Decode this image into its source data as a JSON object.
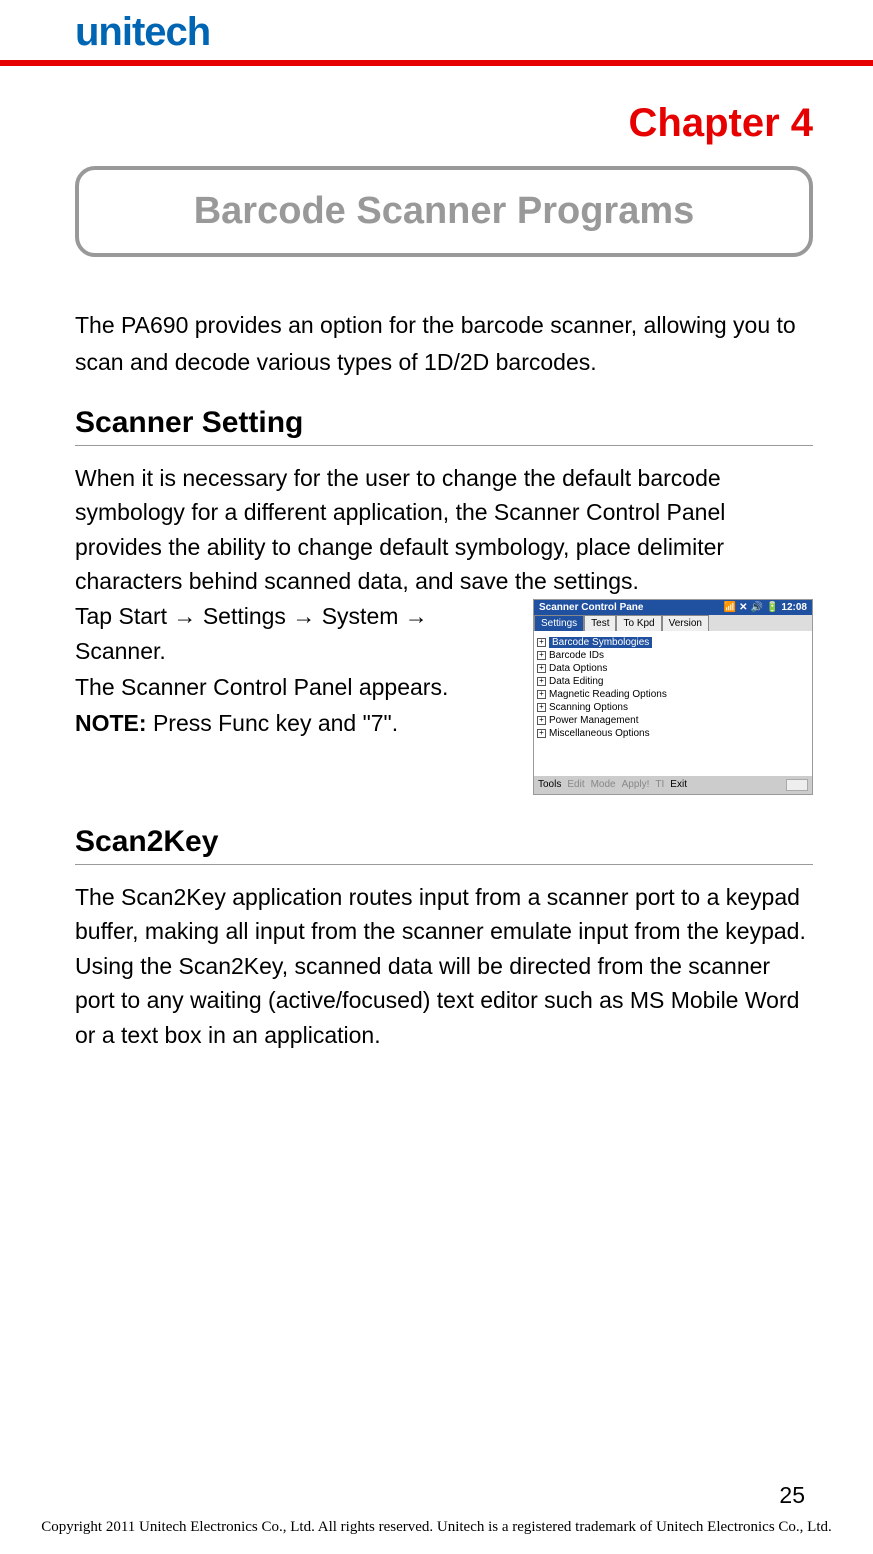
{
  "logo": "unitech",
  "chapter_label": "Chapter  4",
  "chapter_title": "Barcode Scanner Programs",
  "intro": "The PA690 provides an option for the barcode scanner, allowing you to scan and decode various types of 1D/2D barcodes.",
  "sections": {
    "scanner_setting": {
      "heading": "Scanner Setting",
      "para1": "When it is necessary for the user to change the default barcode symbology for a different application, the Scanner Control Panel provides the ability to change default symbology, place delimiter characters behind scanned data, and save the settings.",
      "path": "Tap Start → Settings → System → Scanner.",
      "appears": "The Scanner Control Panel appears.",
      "note_label": "NOTE:",
      "note_text": " Press Func key and \"7\"."
    },
    "scan2key": {
      "heading": "Scan2Key",
      "body": "The Scan2Key application routes input from a scanner port to a keypad buffer, making all input from the scanner emulate input from the keypad. Using the Scan2Key, scanned data will be directed from the scanner port to any waiting (active/focused) text editor such as MS Mobile Word or a text box in an application."
    }
  },
  "screenshot": {
    "title": "Scanner Control Pane",
    "time": "12:08",
    "tabs": [
      "Settings",
      "Test",
      "To Kpd",
      "Version"
    ],
    "tree": [
      "Barcode Symbologies",
      "Barcode IDs",
      "Data Options",
      "Data Editing",
      "Magnetic Reading Options",
      "Scanning Options",
      "Power Management",
      "Miscellaneous Options"
    ],
    "bottom": {
      "tools": "Tools",
      "edit": "Edit",
      "mode": "Mode",
      "apply": "Apply!",
      "ti": "TI",
      "exit": "Exit"
    }
  },
  "page_number": "25",
  "copyright": "Copyright 2011 Unitech Electronics Co., Ltd. All rights reserved. Unitech is a registered trademark of Unitech Electronics Co., Ltd."
}
